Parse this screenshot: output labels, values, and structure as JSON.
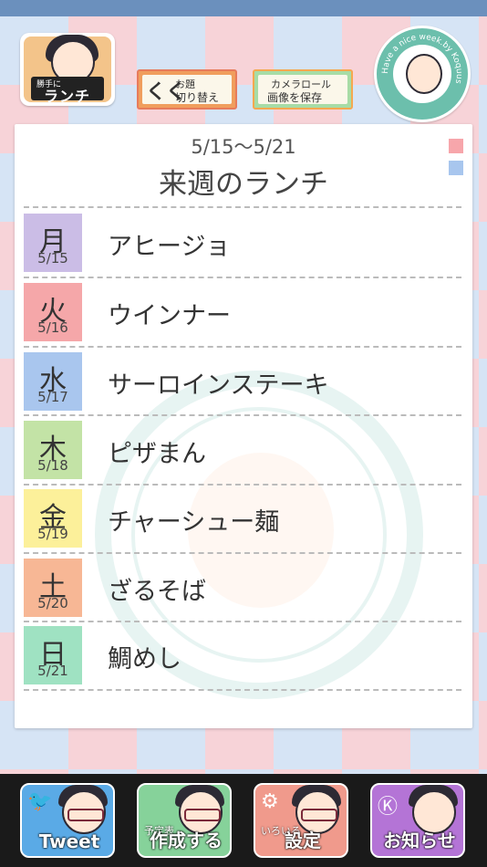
{
  "header": {
    "avatar_sign_small": "勝手に",
    "avatar_sign_big": "ランチ",
    "switch_button": {
      "icon": "くく",
      "line1": "お題",
      "line2": "切り替え"
    },
    "save_button": {
      "line1": "カメラロール",
      "line2": "画像を保存"
    },
    "badge_text": "Have a nice week.by Koquus"
  },
  "card": {
    "week_range": "5/15〜5/21",
    "title": "来週のランチ",
    "days": [
      {
        "kanji": "月",
        "date": "5/15",
        "meal": "アヒージョ",
        "color": "#cbbde6"
      },
      {
        "kanji": "火",
        "date": "5/16",
        "meal": "ウインナー",
        "color": "#f5a7a9"
      },
      {
        "kanji": "水",
        "date": "5/17",
        "meal": "サーロインステーキ",
        "color": "#a9c6ee"
      },
      {
        "kanji": "木",
        "date": "5/18",
        "meal": "ピザまん",
        "color": "#c3e3a6"
      },
      {
        "kanji": "金",
        "date": "5/19",
        "meal": "チャーシュー麺",
        "color": "#fcf09a"
      },
      {
        "kanji": "土",
        "date": "5/20",
        "meal": "ざるそば",
        "color": "#f7b795"
      },
      {
        "kanji": "日",
        "date": "5/21",
        "meal": "鯛めし",
        "color": "#9fe2c2"
      }
    ]
  },
  "footer": {
    "tweet": "Tweet",
    "plan_small": "予定表",
    "plan": "作成する",
    "settings_small": "いろいろ",
    "settings": "設定",
    "news": "お知らせ"
  }
}
